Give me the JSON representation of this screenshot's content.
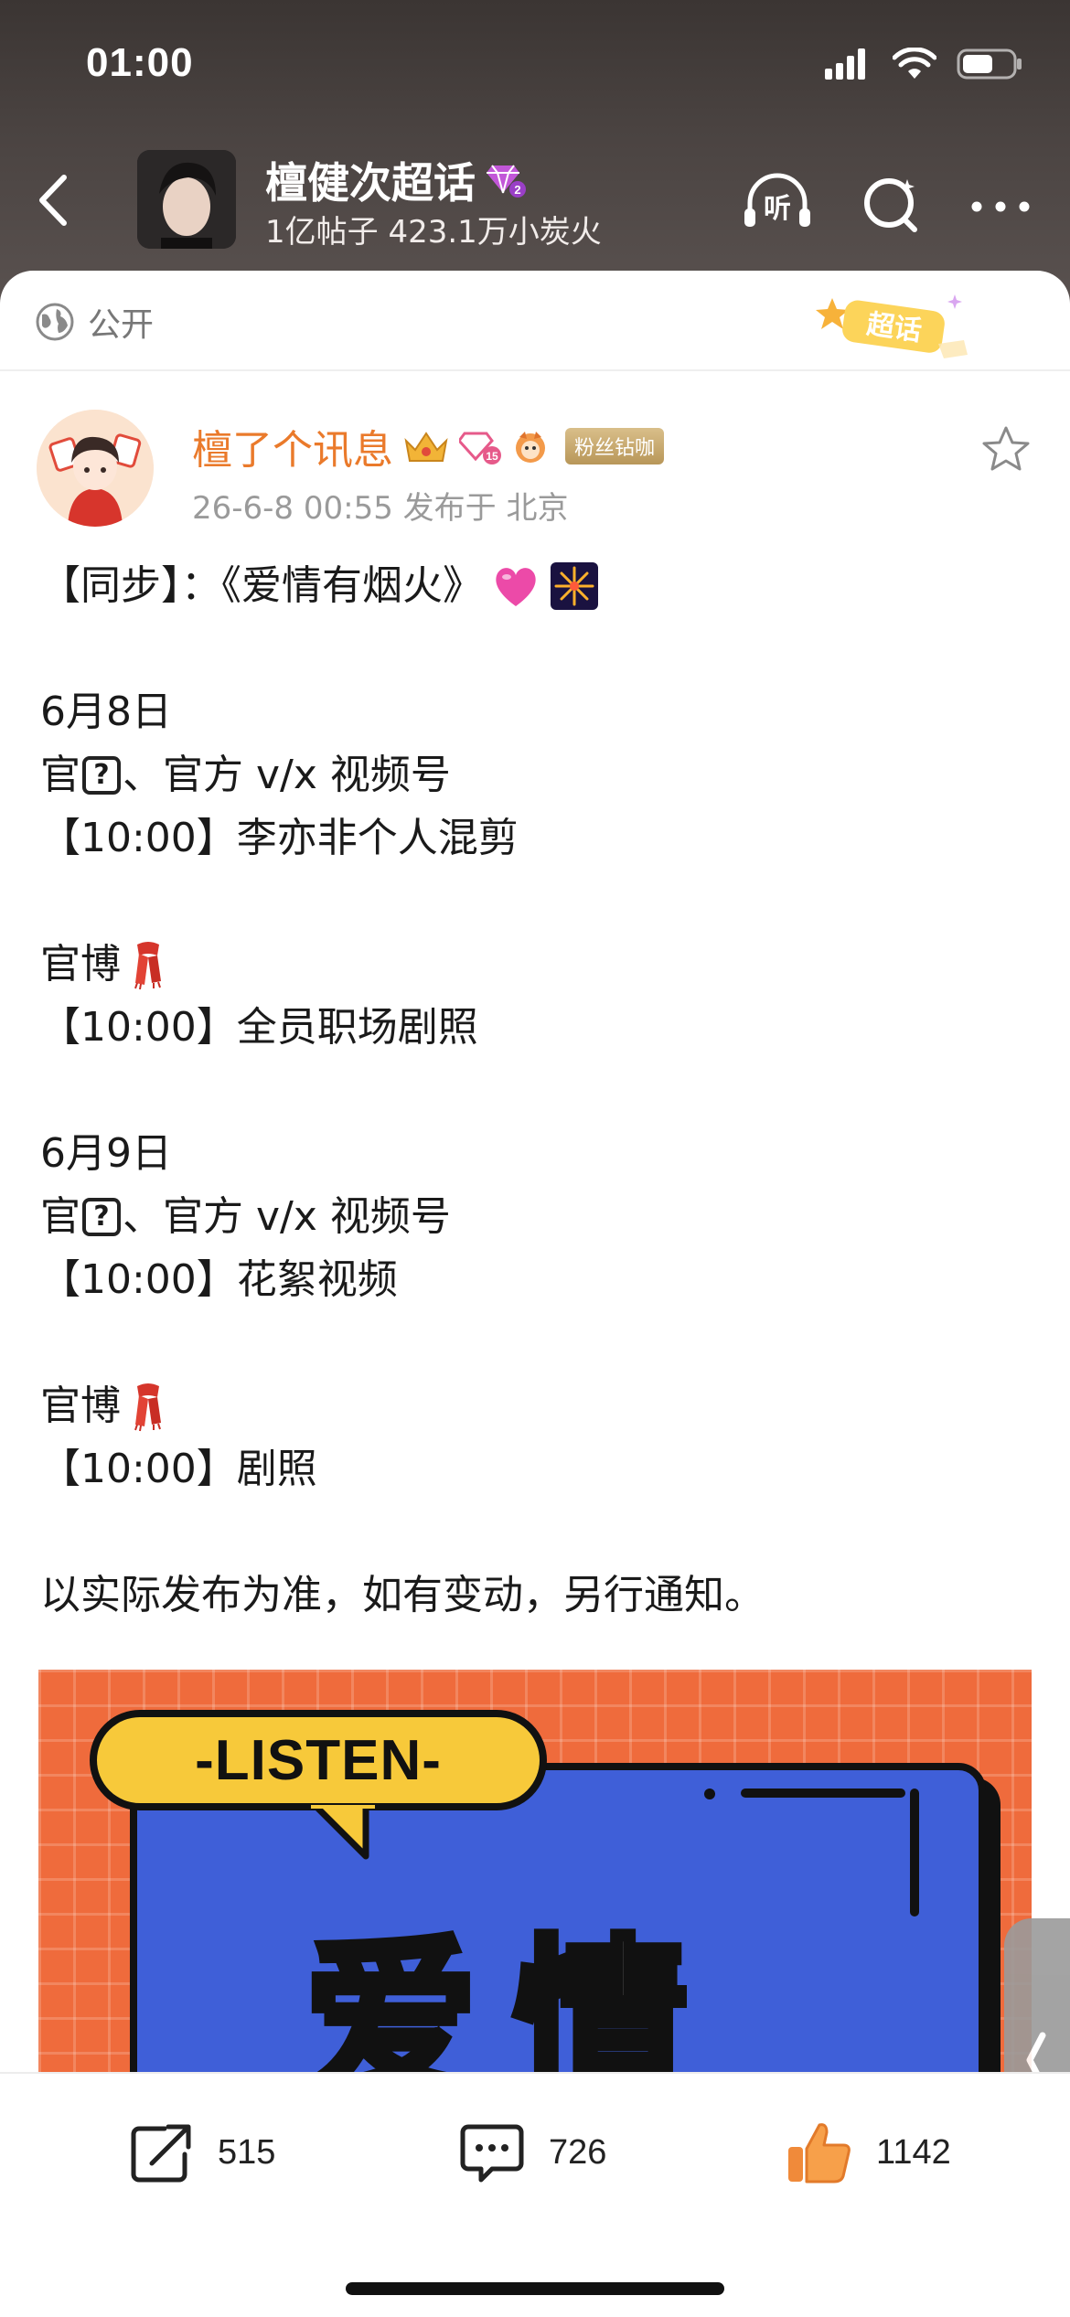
{
  "status_bar": {
    "time": "01:00"
  },
  "header": {
    "topic_name": "檀健次超话",
    "level_badge": "2",
    "stats": "1亿帖子 423.1万小炭火",
    "listen_label": "听"
  },
  "visibility": {
    "label": "公开",
    "badge_text": "超话"
  },
  "post": {
    "author": {
      "name": "檀了个讯息",
      "level_number": "15",
      "fan_badge": "粉丝钻咖"
    },
    "meta": "26-6-8 00:55  发布于 北京",
    "lines": {
      "l1": "【同步】：《爱情有烟火》",
      "d1": "6月8日",
      "d1_a_pre": "官",
      "d1_a_post": "、官方 v/x 视频号",
      "d1_b": "【10:00】李亦非个人混剪",
      "d1_c": "官博",
      "d1_d": "【10:00】全员职场剧照",
      "d2": "6月9日",
      "d2_a_pre": "官",
      "d2_a_post": "、官方 v/x 视频号",
      "d2_b": "【10:00】花絮视频",
      "d2_c": "官博",
      "d2_d": "【10:00】剧照",
      "note": "以实际发布为准，如有变动，另行通知。"
    },
    "qmark": "?",
    "image": {
      "listen_text": "-LISTEN-",
      "title_text": "爱情"
    }
  },
  "actions": {
    "share_count": "515",
    "comment_count": "726",
    "like_count": "1142"
  },
  "colors": {
    "accent_orange": "#ea7a2b",
    "header_bg": "#4b4442",
    "image_bg": "#ef6b3c",
    "image_card": "#3f5fd8"
  }
}
